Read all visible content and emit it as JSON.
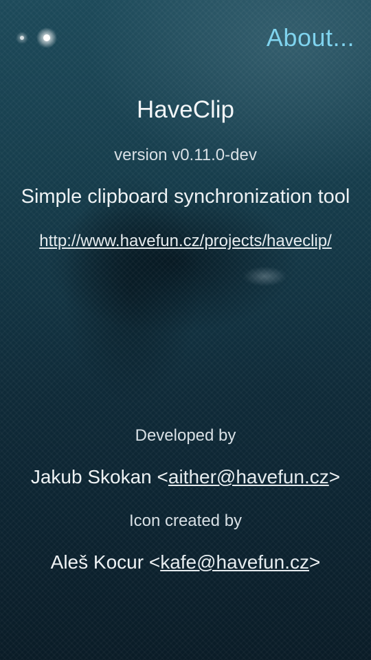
{
  "header": {
    "title": "About..."
  },
  "app": {
    "name": "HaveClip",
    "version": "version v0.11.0-dev",
    "description": "Simple clipboard synchronization tool",
    "url": "http://www.havefun.cz/projects/haveclip/"
  },
  "developer": {
    "label": "Developed by",
    "name": "Jakub Skokan",
    "open": "<",
    "email": "aither@havefun.cz",
    "close": ">"
  },
  "icon_author": {
    "label": "Icon created by",
    "name": "Aleš Kocur",
    "open": "<",
    "email": "kafe@havefun.cz",
    "close": ">"
  },
  "icons": {
    "pulley_menu": "pulley-menu-indicator-icon"
  },
  "colors": {
    "accent": "#7fd3ee",
    "text": "#eef2f4"
  }
}
